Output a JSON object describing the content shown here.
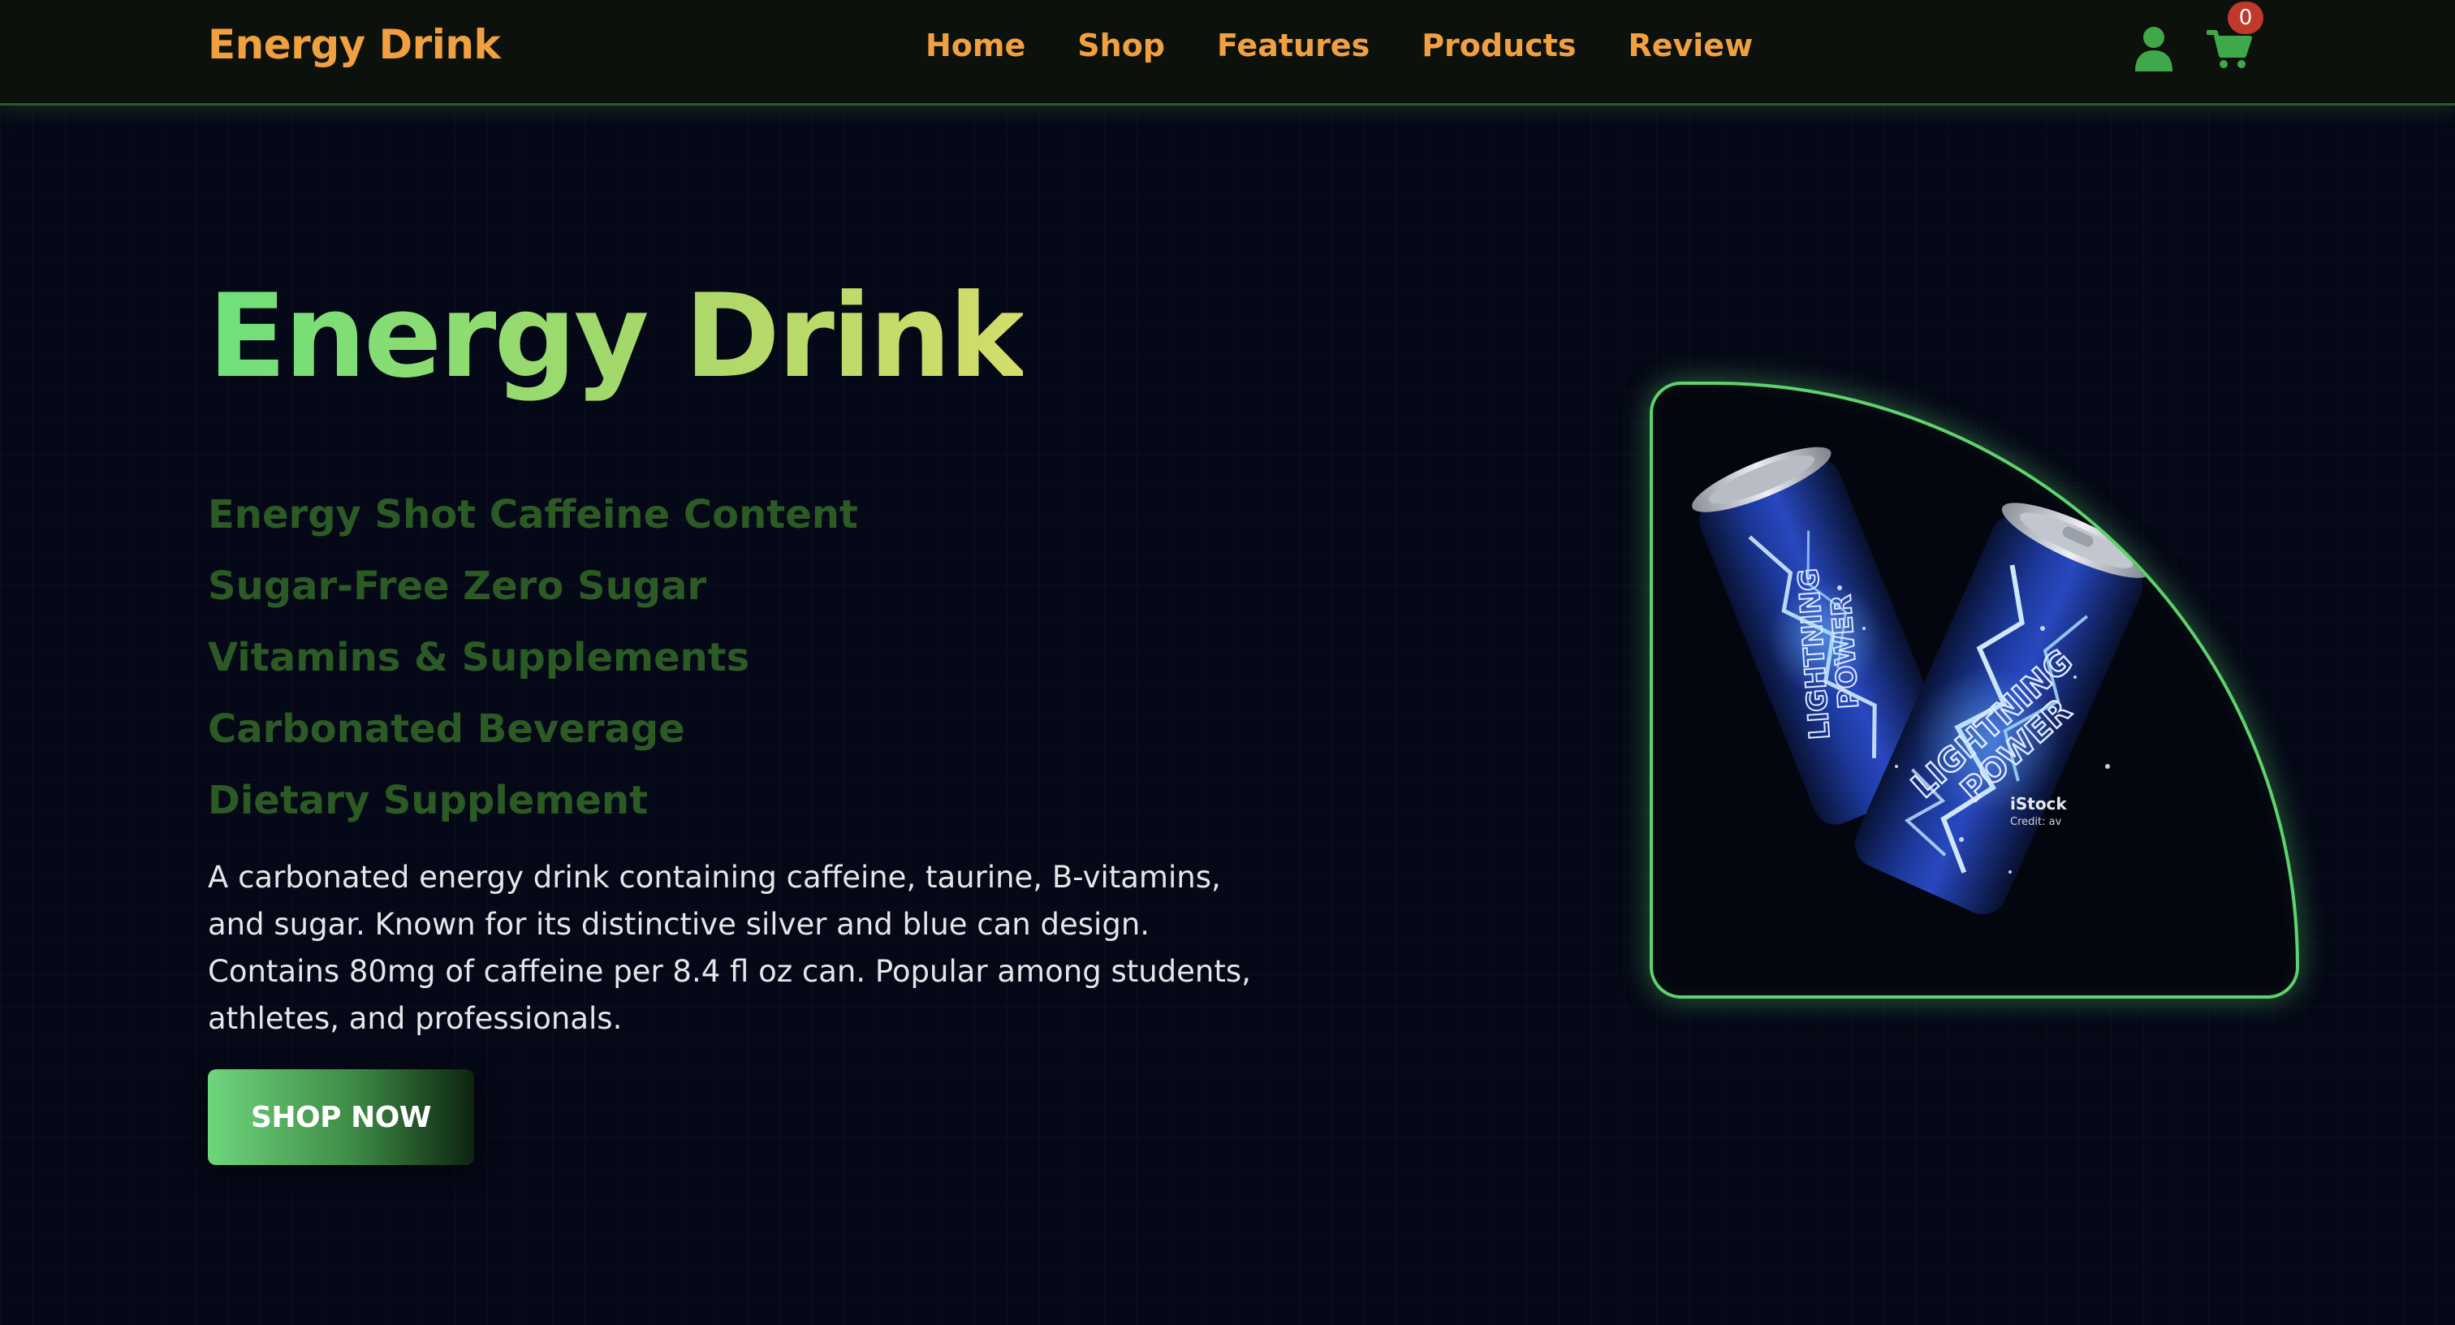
{
  "header": {
    "brand": "Energy Drink",
    "nav": [
      "Home",
      "Shop",
      "Features",
      "Products",
      "Review"
    ],
    "cart_count": "0",
    "icons": {
      "user": "user-icon",
      "cart": "shopping-cart-icon"
    }
  },
  "hero": {
    "title": "Energy Drink",
    "features": [
      "Energy Shot Caffeine Content",
      "Sugar-Free Zero Sugar",
      "Vitamins & Supplements",
      "Carbonated Beverage",
      "Dietary Supplement"
    ],
    "description": "A carbonated energy drink containing caffeine, taurine, B-vitamins, and sugar. Known for its distinctive silver and blue can design. Contains 80mg of caffeine per 8.4 fl oz can. Popular among students, athletes, and professionals.",
    "cta": "SHOP NOW"
  },
  "product_image": {
    "can_label_line1": "LIGHTNING",
    "can_label_line2": "POWER",
    "watermark": "iStock",
    "watermark_credit": "Credit: av"
  },
  "colors": {
    "background": "#050816",
    "nav_background": "#0c120b",
    "accent_orange": "#f0a040",
    "accent_green": "#5ed26c",
    "feature_green": "#2b5a24",
    "badge_red": "#c0392b",
    "can_blue": "#13266e"
  }
}
